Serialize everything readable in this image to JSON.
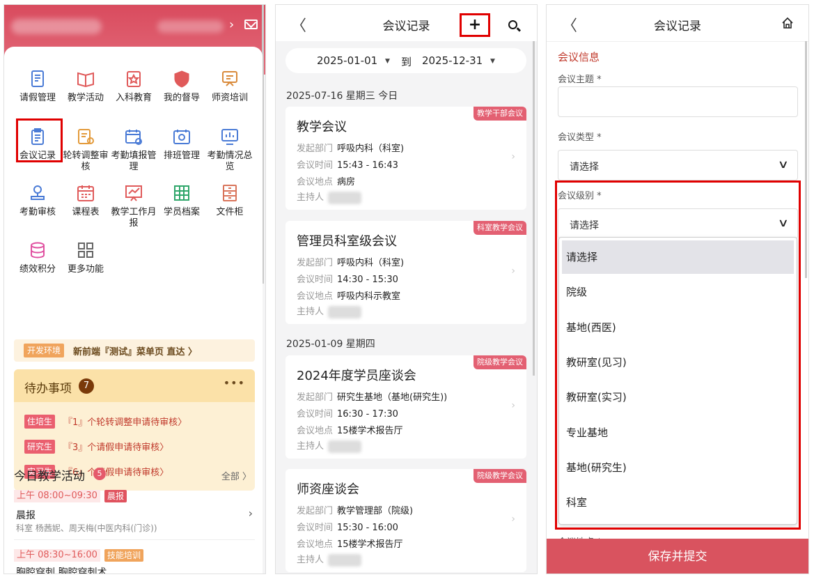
{
  "home": {
    "grid": [
      {
        "label": "请假管理",
        "icon": "leave-icon"
      },
      {
        "label": "教学活动",
        "icon": "book-icon"
      },
      {
        "label": "入科教育",
        "icon": "education-icon"
      },
      {
        "label": "我的督导",
        "icon": "supervise-icon"
      },
      {
        "label": "师资培训",
        "icon": "teacher-training-icon"
      },
      {
        "label": "会议记录",
        "icon": "meeting-record-icon"
      },
      {
        "label": "轮转调整审核",
        "icon": "rotation-audit-icon"
      },
      {
        "label": "考勤填报管理",
        "icon": "attendance-report-icon"
      },
      {
        "label": "排班管理",
        "icon": "schedule-icon"
      },
      {
        "label": "考勤情况总览",
        "icon": "attendance-overview-icon"
      },
      {
        "label": "考勤审核",
        "icon": "stamp-icon"
      },
      {
        "label": "课程表",
        "icon": "calendar-icon"
      },
      {
        "label": "教学工作月报",
        "icon": "monthly-report-icon"
      },
      {
        "label": "学员档案",
        "icon": "archive-icon"
      },
      {
        "label": "文件柜",
        "icon": "cabinet-icon"
      },
      {
        "label": "绩效积分",
        "icon": "points-icon"
      },
      {
        "label": "更多功能",
        "icon": "more-icon"
      }
    ],
    "dev_tag": "开发环境",
    "dev_text": "新前端『测试』菜单页 直达 〉",
    "todo": {
      "title": "待办事项",
      "count": "7",
      "more": "•••",
      "items": [
        {
          "tag": "住培生",
          "text": "『1』个轮转调整申请待审核〉"
        },
        {
          "tag": "研究生",
          "text": "『3』个请假申请待审核〉"
        },
        {
          "tag": "实习生",
          "text": "『6』个请假申请待审核〉"
        }
      ]
    },
    "activity": {
      "title": "今日教学活动",
      "count": "5",
      "all": "全部 〉",
      "items": [
        {
          "time": "上午 08:00~09:30",
          "tag": "晨报",
          "tag_color": "#e0535f",
          "name": "晨报",
          "desc": "科室 杨茜妮、周天梅(中医内科(门诊))"
        },
        {
          "time": "上午 08:30~16:00",
          "tag": "技能培训",
          "tag_color": "#f0a45c",
          "name": "胸腔穿刺 胸腔穿刺术"
        }
      ]
    }
  },
  "list": {
    "title": "会议记录",
    "back": "〈",
    "add": "+",
    "date_from": "2025-01-01",
    "to": "到",
    "date_to": "2025-12-31",
    "groups": [
      {
        "date": "2025-07-16 星期三 今日"
      },
      {
        "date": "2025-01-09 星期四"
      }
    ],
    "labels": {
      "dept": "发起部门",
      "time": "会议时间",
      "place": "会议地点",
      "host": "主持人"
    },
    "meetings": [
      {
        "tag": "教学干部会议",
        "title": "教学会议",
        "dept": "呼吸内科（科室)",
        "time": "15:43 - 16:43",
        "place": "病房"
      },
      {
        "tag": "科室教学会议",
        "title": "管理员科室级会议",
        "dept": "呼吸内科（科室)",
        "time": "14:30 - 15:30",
        "place": "呼吸内科示教室"
      },
      {
        "tag": "院级教学会议",
        "title": "2024年度学员座谈会",
        "dept": "研究生基地（基地(研究生))",
        "time": "16:30 - 17:30",
        "place": "15楼学术报告厅"
      },
      {
        "tag": "院级教学会议",
        "title": "师资座谈会",
        "dept": "教学管理部（院级)",
        "time": "15:30 - 16:00",
        "place": "15楼学术报告厅"
      }
    ]
  },
  "form": {
    "title": "会议记录",
    "back": "〈",
    "section": "会议信息",
    "topic_label": "会议主题 *",
    "type_label": "会议类型 *",
    "type_value": "请选择",
    "level_label": "会议级别 *",
    "level_value": "请选择",
    "options": [
      "请选择",
      "院级",
      "基地(西医)",
      "教研室(见习)",
      "教研室(实习)",
      "专业基地",
      "基地(研究生)",
      "科室"
    ],
    "underlay_label": "会议地点 *",
    "submit": "保存并提交"
  },
  "colors": {
    "accent": "#d9535f",
    "highlight": "#e00000",
    "todo_bg": "#fdf0d4"
  }
}
